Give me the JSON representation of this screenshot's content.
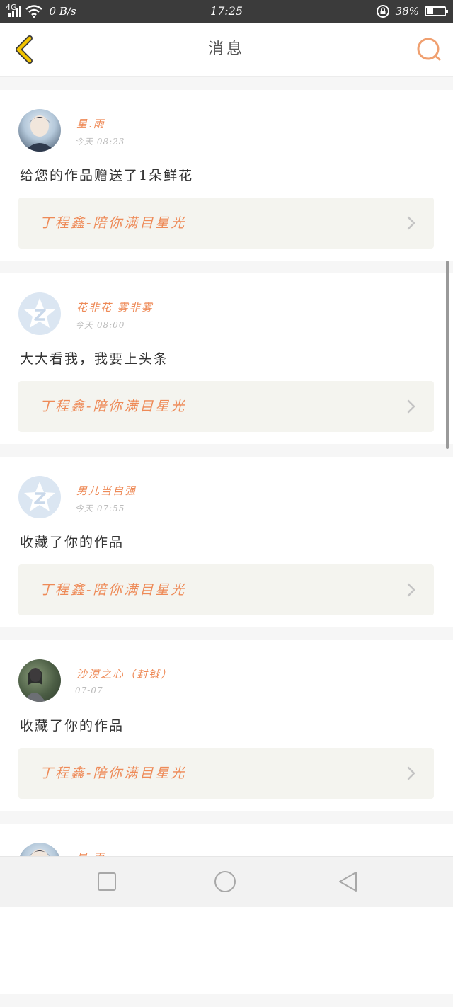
{
  "status_bar": {
    "network": "4G",
    "speed": "0 B/s",
    "time": "17:25",
    "battery_text": "38%",
    "battery_level": 0.38,
    "icons": [
      "signal-icon",
      "wifi-icon",
      "rotation-lock-icon",
      "battery-icon"
    ]
  },
  "header": {
    "title": "消息",
    "back_icon": "chevron-left-icon",
    "search_icon": "search-icon",
    "accent": "#f0a070",
    "back_color": "#f2c400"
  },
  "colors": {
    "accent_text": "#ee8a57",
    "card_link_bg": "#f4f4ef",
    "page_bg": "#f6f6f6"
  },
  "notifications": [
    {
      "user": "星.雨",
      "time": "今天 08:23",
      "message": "给您的作品赠送了1朵鲜花",
      "work": "丁程鑫-陪你满目星光",
      "avatar": "photo-boy"
    },
    {
      "user": "花非花 雾非雾",
      "time": "今天 08:00",
      "message": "大大看我，我要上头条",
      "work": "丁程鑫-陪你满目星光",
      "avatar": "qq-default"
    },
    {
      "user": "男儿当自强",
      "time": "今天 07:55",
      "message": "收藏了你的作品",
      "work": "丁程鑫-陪你满目星光",
      "avatar": "qq-default"
    },
    {
      "user": "沙漠之心（封铖）",
      "time": "07-07",
      "message": "收藏了你的作品",
      "work": "丁程鑫-陪你满目星光",
      "avatar": "photo-girl"
    },
    {
      "user": "星.雨",
      "time": "",
      "message": "",
      "work": "",
      "avatar": "photo-boy"
    }
  ],
  "nav": {
    "recent_icon": "square-icon",
    "home_icon": "circle-icon",
    "back_icon": "triangle-back-icon"
  }
}
